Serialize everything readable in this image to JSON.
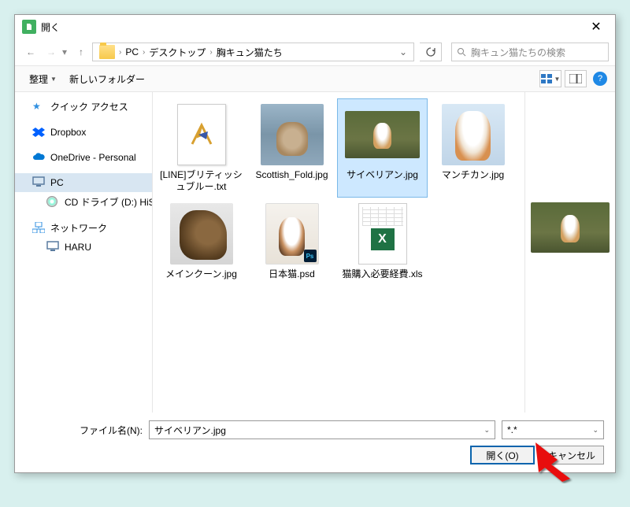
{
  "title": "開く",
  "breadcrumb": {
    "pc": "PC",
    "desktop": "デスクトップ",
    "folder": "胸キュン猫たち"
  },
  "search": {
    "placeholder": "胸キュン猫たちの検索"
  },
  "toolbar": {
    "organize": "整理",
    "newfolder": "新しいフォルダー"
  },
  "sidebar": {
    "quick": "クイック アクセス",
    "dropbox": "Dropbox",
    "onedrive": "OneDrive - Personal",
    "pc": "PC",
    "cd": "CD ドライブ (D:) HiSuite",
    "network": "ネットワーク",
    "haru": "HARU"
  },
  "files": [
    {
      "name": "[LINE]ブリティッシュブルー.txt"
    },
    {
      "name": "Scottish_Fold.jpg"
    },
    {
      "name": "サイベリアン.jpg"
    },
    {
      "name": "マンチカン.jpg"
    },
    {
      "name": "メインクーン.jpg"
    },
    {
      "name": "日本猫.psd"
    },
    {
      "name": "猫購入必要経費.xls"
    }
  ],
  "footer": {
    "filename_label": "ファイル名(N):",
    "filename_value": "サイベリアン.jpg",
    "filter": "*.*",
    "open": "開く(O)",
    "cancel": "キャンセル"
  }
}
